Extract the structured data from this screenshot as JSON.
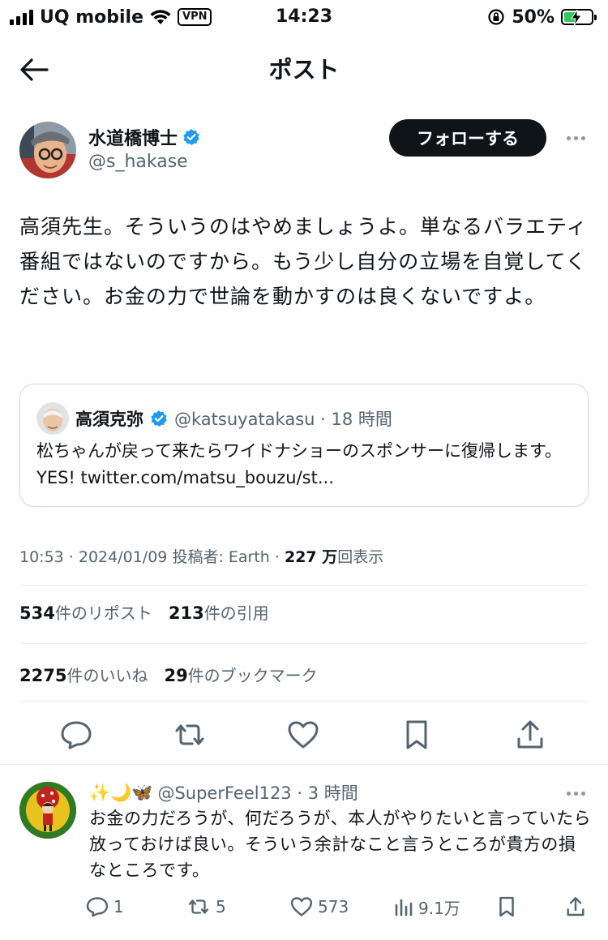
{
  "status_bar": {
    "carrier": "UQ mobile",
    "vpn": "VPN",
    "time": "14:23",
    "battery_percent": "50%",
    "battery_level": 0.5,
    "battery_color": "#34c759"
  },
  "nav": {
    "title": "ポスト",
    "back_icon": "arrow-left-icon"
  },
  "author": {
    "name": "水道橋博士",
    "handle": "@s_hakase",
    "verified": true,
    "follow_label": "フォローする"
  },
  "tweet": {
    "text": "高須先生。そういうのはやめましょうよ。単なるバラエティ番組ではないのですから。もう少し自分の立場を自覚してください。お金の力で世論を動かすのは良くないですよ。"
  },
  "quote": {
    "name": "高須克弥",
    "meta": "@katsuyatakasu · 18 時間",
    "text": "松ちゃんが戻って来たらワイドナショーのスポンサーに復帰します。YES! twitter.com/matsu_bouzu/st..."
  },
  "meta": {
    "timestamp": "10:53 · 2024/01/09",
    "posted_by": "投稿者: Earth ·",
    "views": "227 万",
    "views_suffix": "回表示"
  },
  "stats": {
    "reposts": "534",
    "reposts_label": "件のリポスト",
    "quotes": "213",
    "quotes_label": "件の引用",
    "likes": "2275",
    "likes_label": "件のいいね",
    "bookmarks": "29",
    "bookmarks_label": "件のブックマーク"
  },
  "actions": [
    "reply-icon",
    "repost-icon",
    "like-icon",
    "bookmark-icon",
    "share-icon"
  ],
  "reply": {
    "name_emoji": "✨🌙🦋",
    "meta": "@SuperFeel123 · 3 時間",
    "text": "お金の力だろうが、何だろうが、本人がやりたいと言っていたら放っておけば良い。そういう余計なこと言うところが貴方の損なところです。",
    "reply_count": "1",
    "repost_count": "5",
    "like_count": "573",
    "view_count": "9.1万"
  },
  "colors": {
    "verified": "#1d9bf0",
    "text": "#0f1419",
    "secondary": "#536471",
    "border": "#cfd9de"
  }
}
